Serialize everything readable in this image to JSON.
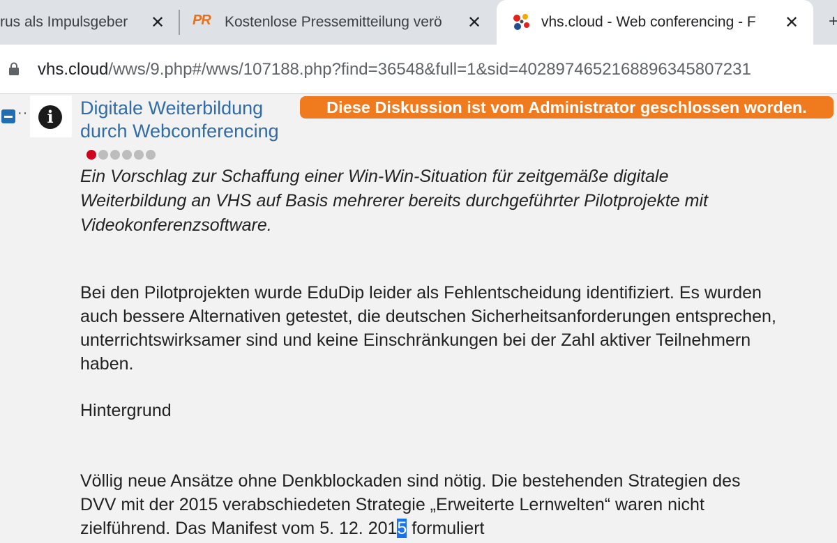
{
  "tabs": [
    {
      "title": "rus als Impulsgeber",
      "close_glyph": "✕"
    },
    {
      "favicon_text": "PR",
      "title": "Kostenlose Pressemitteilung verö",
      "close_glyph": "✕"
    },
    {
      "title": "vhs.cloud - Web conferencing - F",
      "close_glyph": "✕",
      "active": true
    }
  ],
  "new_tab_glyph": "+",
  "address_bar": {
    "domain": "vhs.cloud",
    "path": "/wws/9.php#/wws/107188.php?find=36548&full=1&sid=4028974652168896345807231"
  },
  "discussion": {
    "title": "Digitale Weiterbildung durch Webconferencing",
    "closed_notice": "Diese Diskussion ist vom Administrator geschlossen worden.",
    "rating": {
      "filled": 1,
      "total": 6,
      "active_color": "#d0021b"
    },
    "info_icon": "i",
    "collapse_dots": "··",
    "abstract": "Ein Vorschlag zur Schaffung einer Win-Win-Situation für zeitgemäße digitale Weiterbildung an VHS auf Basis mehrerer bereits durchgeführter Pilotprojekte mit Videokonferenzsoftware.",
    "paragraph1": "Bei den Pilotprojekten wurde EduDip leider als Fehlentscheidung identifiziert. Es wurden auch bessere Alternativen getestet, die deutschen Sicherheitsanforderungen entsprechen, unterrichtswirksamer sind und keine Einschränkungen bei der Zahl aktiver Teilnehmern haben.",
    "heading": "Hintergrund",
    "paragraph3_before": "Völlig neue Ansätze ohne Denkblockaden sind nötig. Die bestehenden Strategien des DVV mit der 2015 verabschiedeten Strategie „Erweiterte Lernwelten“ waren nicht zielführend. Das Manifest vom 5. 12. 201",
    "paragraph3_selected": "5",
    "paragraph3_after": " formuliert"
  },
  "colors": {
    "link": "#2f6ca8",
    "badge": "#f07a1e",
    "selection": "#1a73e8",
    "expand_toggle": "#1f6fb2"
  }
}
